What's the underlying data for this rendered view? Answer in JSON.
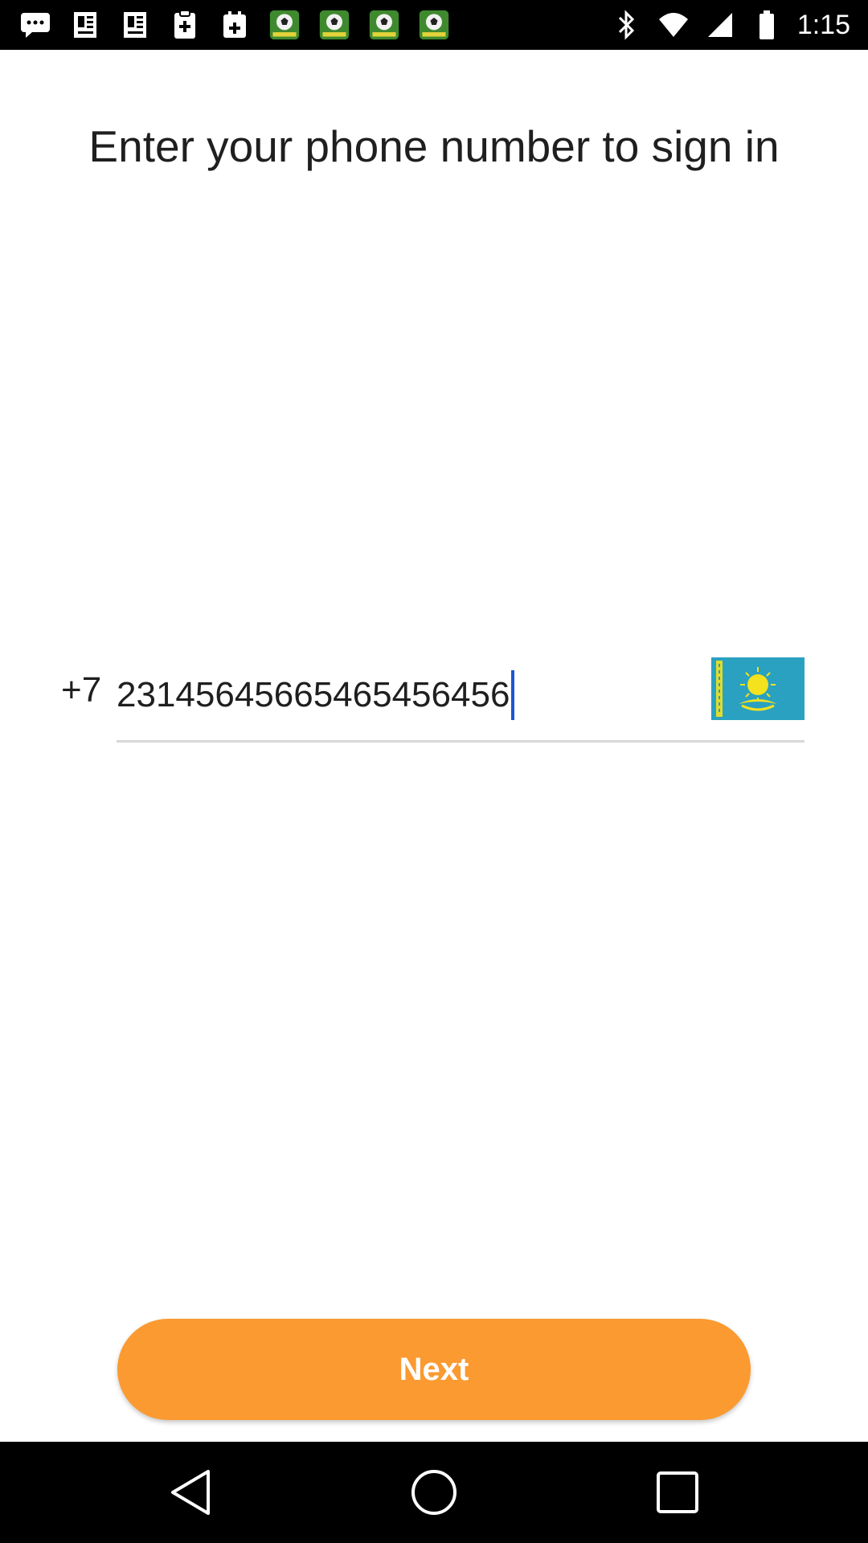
{
  "status_bar": {
    "time": "1:15",
    "left_icons": [
      "message-icon",
      "news-icon",
      "news-icon",
      "clipboard-icon",
      "calendar-icon",
      "soccer-app-icon",
      "soccer-app-icon",
      "soccer-app-icon",
      "soccer-app-icon"
    ],
    "right_icons": [
      "bluetooth-icon",
      "wifi-icon",
      "signal-icon",
      "battery-icon"
    ]
  },
  "page": {
    "title": "Enter your phone number to sign in"
  },
  "phone": {
    "country_code": "+7",
    "number": "2314564566546545645​6",
    "country_flag": "kazakhstan-flag",
    "flag_color": "#2aa1c0",
    "sun_color": "#f3e21d"
  },
  "next_button": {
    "label": "Next",
    "color": "#fb9a30"
  },
  "nav_bar": {
    "buttons": [
      "back-icon",
      "home-icon",
      "recents-icon"
    ]
  }
}
